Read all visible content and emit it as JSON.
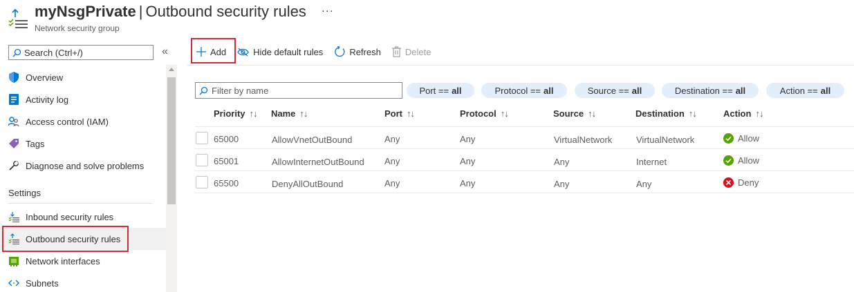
{
  "header": {
    "resource_name": "myNsgPrivate",
    "separator": "|",
    "page_title": "Outbound security rules",
    "more": "···",
    "subtitle": "Network security group"
  },
  "sidebar": {
    "search_placeholder": "Search (Ctrl+/)",
    "collapse_glyph": "«",
    "items": [
      {
        "label": "Overview",
        "icon": "shield-icon"
      },
      {
        "label": "Activity log",
        "icon": "activity-log-icon"
      },
      {
        "label": "Access control (IAM)",
        "icon": "people-icon"
      },
      {
        "label": "Tags",
        "icon": "tag-icon"
      },
      {
        "label": "Diagnose and solve problems",
        "icon": "wrench-icon"
      }
    ],
    "section_settings": "Settings",
    "settings_items": [
      {
        "label": "Inbound security rules",
        "icon": "inbound-rules-icon"
      },
      {
        "label": "Outbound security rules",
        "icon": "outbound-rules-icon",
        "active": true
      },
      {
        "label": "Network interfaces",
        "icon": "network-interface-icon"
      },
      {
        "label": "Subnets",
        "icon": "subnet-icon"
      }
    ]
  },
  "toolbar": {
    "add": "Add",
    "hide_default": "Hide default rules",
    "refresh": "Refresh",
    "delete": "Delete"
  },
  "filters": {
    "filter_placeholder": "Filter by name",
    "pills": [
      {
        "key": "Port ==",
        "value": "all"
      },
      {
        "key": "Protocol ==",
        "value": "all"
      },
      {
        "key": "Source ==",
        "value": "all"
      },
      {
        "key": "Destination ==",
        "value": "all"
      },
      {
        "key": "Action ==",
        "value": "all"
      }
    ]
  },
  "table": {
    "columns": [
      "Priority",
      "Name",
      "Port",
      "Protocol",
      "Source",
      "Destination",
      "Action"
    ],
    "sort_glyph": "↑↓",
    "rows": [
      {
        "priority": "65000",
        "name": "AllowVnetOutBound",
        "port": "Any",
        "protocol": "Any",
        "source": "VirtualNetwork",
        "destination": "VirtualNetwork",
        "action": "Allow"
      },
      {
        "priority": "65001",
        "name": "AllowInternetOutBound",
        "port": "Any",
        "protocol": "Any",
        "source": "Any",
        "destination": "Internet",
        "action": "Allow"
      },
      {
        "priority": "65500",
        "name": "DenyAllOutBound",
        "port": "Any",
        "protocol": "Any",
        "source": "Any",
        "destination": "Any",
        "action": "Deny"
      }
    ]
  },
  "colors": {
    "accent": "#0078d4",
    "highlight": "#d12b3a",
    "allow": "#57a300",
    "deny": "#e00b1c",
    "pill_bg": "#e3eefb"
  }
}
